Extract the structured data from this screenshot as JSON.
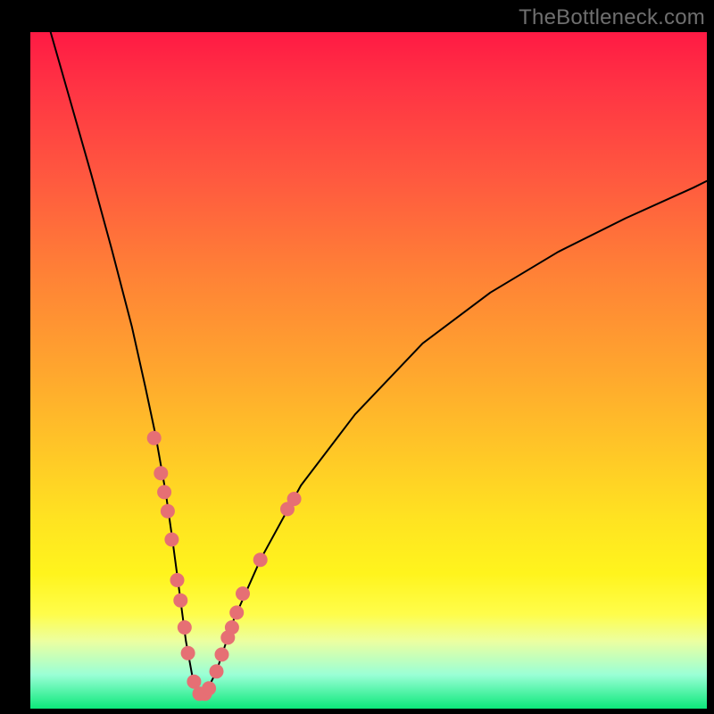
{
  "watermark": "TheBottleneck.com",
  "colors": {
    "frame_bg_top": "#ff1a44",
    "frame_bg_bottom": "#0ce87a",
    "curve_stroke": "#000000",
    "dot_fill": "#e66f74",
    "page_bg": "#000000",
    "watermark_text": "#6f6f6f"
  },
  "chart_data": {
    "type": "line",
    "title": "",
    "xlabel": "",
    "ylabel": "",
    "x_range": [
      0,
      100
    ],
    "y_range": [
      0,
      100
    ],
    "grid": false,
    "legend": false,
    "curve": {
      "name": "bottleneck-curve",
      "x": [
        3.0,
        6.0,
        9.0,
        12.0,
        15.0,
        17.0,
        18.5,
        20.0,
        21.0,
        22.0,
        23.0,
        24.0,
        25.0,
        26.0,
        27.5,
        30.0,
        34.0,
        40.0,
        48.0,
        58.0,
        68.0,
        78.0,
        88.0,
        98.0,
        100.0
      ],
      "y": [
        100.0,
        89.5,
        79.0,
        68.0,
        56.5,
        47.5,
        40.5,
        32.0,
        25.0,
        17.5,
        10.0,
        4.5,
        2.0,
        2.5,
        5.5,
        13.0,
        22.0,
        33.0,
        43.5,
        54.0,
        61.5,
        67.5,
        72.5,
        77.0,
        78.0
      ]
    },
    "data_points": [
      {
        "x": 18.3,
        "y": 40.0
      },
      {
        "x": 19.3,
        "y": 34.8
      },
      {
        "x": 19.8,
        "y": 32.0
      },
      {
        "x": 20.3,
        "y": 29.2
      },
      {
        "x": 20.9,
        "y": 25.0
      },
      {
        "x": 21.7,
        "y": 19.0
      },
      {
        "x": 22.2,
        "y": 16.0
      },
      {
        "x": 22.8,
        "y": 12.0
      },
      {
        "x": 23.3,
        "y": 8.2
      },
      {
        "x": 24.2,
        "y": 4.0
      },
      {
        "x": 25.0,
        "y": 2.2
      },
      {
        "x": 25.8,
        "y": 2.2
      },
      {
        "x": 26.4,
        "y": 3.0
      },
      {
        "x": 27.5,
        "y": 5.5
      },
      {
        "x": 28.3,
        "y": 8.0
      },
      {
        "x": 29.2,
        "y": 10.5
      },
      {
        "x": 29.8,
        "y": 12.0
      },
      {
        "x": 30.5,
        "y": 14.2
      },
      {
        "x": 31.4,
        "y": 17.0
      },
      {
        "x": 34.0,
        "y": 22.0
      },
      {
        "x": 38.0,
        "y": 29.5
      },
      {
        "x": 39.0,
        "y": 31.0
      }
    ]
  }
}
